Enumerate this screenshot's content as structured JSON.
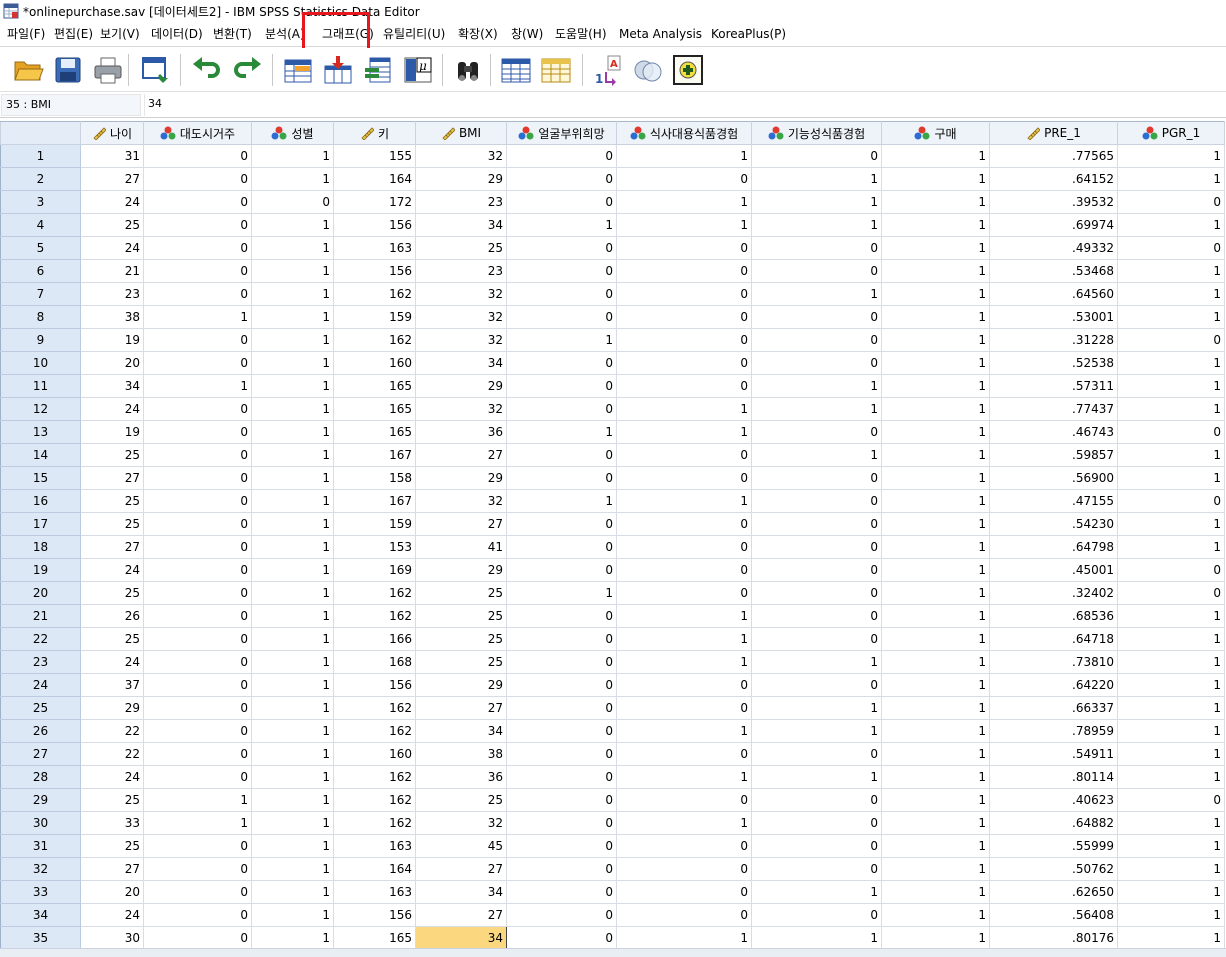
{
  "window": {
    "title": "*onlinepurchase.sav [데이터세트2] - IBM SPSS Statistics Data Editor"
  },
  "menu": [
    {
      "label": "파일(F)",
      "name": "menu-file"
    },
    {
      "label": "편집(E)",
      "name": "menu-edit"
    },
    {
      "label": "보기(V)",
      "name": "menu-view"
    },
    {
      "label": "데이터(D)",
      "name": "menu-data"
    },
    {
      "label": "변환(T)",
      "name": "menu-transform"
    },
    {
      "label": "분석(A)",
      "name": "menu-analyze"
    },
    {
      "label": "그래프(G)",
      "name": "menu-graphs"
    },
    {
      "label": "유틸리티(U)",
      "name": "menu-utilities"
    },
    {
      "label": "확장(X)",
      "name": "menu-extensions"
    },
    {
      "label": "창(W)",
      "name": "menu-window"
    },
    {
      "label": "도움말(H)",
      "name": "menu-help"
    },
    {
      "label": "Meta Analysis",
      "name": "menu-meta-analysis"
    },
    {
      "label": "KoreaPlus(P)",
      "name": "menu-koreaplus"
    }
  ],
  "toolbar": [
    {
      "icon": "open-folder-icon"
    },
    {
      "icon": "save-icon"
    },
    {
      "icon": "print-icon"
    },
    {
      "icon": "recall-dialog-icon"
    },
    {
      "icon": "undo-icon"
    },
    {
      "icon": "redo-icon"
    },
    {
      "icon": "goto-case-icon"
    },
    {
      "icon": "goto-variable-icon"
    },
    {
      "icon": "variables-icon"
    },
    {
      "icon": "descriptive-statistics-icon"
    },
    {
      "icon": "find-icon"
    },
    {
      "icon": "insert-cases-icon"
    },
    {
      "icon": "insert-variable-icon"
    },
    {
      "icon": "value-labels-icon"
    },
    {
      "icon": "use-variable-sets-icon"
    },
    {
      "icon": "show-all-variables-icon"
    }
  ],
  "cellbar": {
    "reference": "35 : BMI",
    "value": "34"
  },
  "columns": [
    {
      "label": "나이",
      "type": "scale"
    },
    {
      "label": "대도시거주",
      "type": "nominal"
    },
    {
      "label": "성별",
      "type": "nominal"
    },
    {
      "label": "키",
      "type": "scale"
    },
    {
      "label": "BMI",
      "type": "scale"
    },
    {
      "label": "얼굴부위희망",
      "type": "nominal"
    },
    {
      "label": "식사대용식품경험",
      "type": "nominal"
    },
    {
      "label": "기능성식품경험",
      "type": "nominal"
    },
    {
      "label": "구매",
      "type": "nominal"
    },
    {
      "label": "PRE_1",
      "type": "scale"
    },
    {
      "label": "PGR_1",
      "type": "nominal"
    }
  ],
  "rows": [
    [
      "1",
      "31",
      "0",
      "1",
      "155",
      "32",
      "0",
      "1",
      "0",
      "1",
      ".77565",
      "1"
    ],
    [
      "2",
      "27",
      "0",
      "1",
      "164",
      "29",
      "0",
      "0",
      "1",
      "1",
      ".64152",
      "1"
    ],
    [
      "3",
      "24",
      "0",
      "0",
      "172",
      "23",
      "0",
      "1",
      "1",
      "1",
      ".39532",
      "0"
    ],
    [
      "4",
      "25",
      "0",
      "1",
      "156",
      "34",
      "1",
      "1",
      "1",
      "1",
      ".69974",
      "1"
    ],
    [
      "5",
      "24",
      "0",
      "1",
      "163",
      "25",
      "0",
      "0",
      "0",
      "1",
      ".49332",
      "0"
    ],
    [
      "6",
      "21",
      "0",
      "1",
      "156",
      "23",
      "0",
      "0",
      "0",
      "1",
      ".53468",
      "1"
    ],
    [
      "7",
      "23",
      "0",
      "1",
      "162",
      "32",
      "0",
      "0",
      "1",
      "1",
      ".64560",
      "1"
    ],
    [
      "8",
      "38",
      "1",
      "1",
      "159",
      "32",
      "0",
      "0",
      "0",
      "1",
      ".53001",
      "1"
    ],
    [
      "9",
      "19",
      "0",
      "1",
      "162",
      "32",
      "1",
      "0",
      "0",
      "1",
      ".31228",
      "0"
    ],
    [
      "10",
      "20",
      "0",
      "1",
      "160",
      "34",
      "0",
      "0",
      "0",
      "1",
      ".52538",
      "1"
    ],
    [
      "11",
      "34",
      "1",
      "1",
      "165",
      "29",
      "0",
      "0",
      "1",
      "1",
      ".57311",
      "1"
    ],
    [
      "12",
      "24",
      "0",
      "1",
      "165",
      "32",
      "0",
      "1",
      "1",
      "1",
      ".77437",
      "1"
    ],
    [
      "13",
      "19",
      "0",
      "1",
      "165",
      "36",
      "1",
      "1",
      "0",
      "1",
      ".46743",
      "0"
    ],
    [
      "14",
      "25",
      "0",
      "1",
      "167",
      "27",
      "0",
      "0",
      "1",
      "1",
      ".59857",
      "1"
    ],
    [
      "15",
      "27",
      "0",
      "1",
      "158",
      "29",
      "0",
      "0",
      "0",
      "1",
      ".56900",
      "1"
    ],
    [
      "16",
      "25",
      "0",
      "1",
      "167",
      "32",
      "1",
      "1",
      "0",
      "1",
      ".47155",
      "0"
    ],
    [
      "17",
      "25",
      "0",
      "1",
      "159",
      "27",
      "0",
      "0",
      "0",
      "1",
      ".54230",
      "1"
    ],
    [
      "18",
      "27",
      "0",
      "1",
      "153",
      "41",
      "0",
      "0",
      "0",
      "1",
      ".64798",
      "1"
    ],
    [
      "19",
      "24",
      "0",
      "1",
      "169",
      "29",
      "0",
      "0",
      "0",
      "1",
      ".45001",
      "0"
    ],
    [
      "20",
      "25",
      "0",
      "1",
      "162",
      "25",
      "1",
      "0",
      "0",
      "1",
      ".32402",
      "0"
    ],
    [
      "21",
      "26",
      "0",
      "1",
      "162",
      "25",
      "0",
      "1",
      "0",
      "1",
      ".68536",
      "1"
    ],
    [
      "22",
      "25",
      "0",
      "1",
      "166",
      "25",
      "0",
      "1",
      "0",
      "1",
      ".64718",
      "1"
    ],
    [
      "23",
      "24",
      "0",
      "1",
      "168",
      "25",
      "0",
      "1",
      "1",
      "1",
      ".73810",
      "1"
    ],
    [
      "24",
      "37",
      "0",
      "1",
      "156",
      "29",
      "0",
      "0",
      "0",
      "1",
      ".64220",
      "1"
    ],
    [
      "25",
      "29",
      "0",
      "1",
      "162",
      "27",
      "0",
      "0",
      "1",
      "1",
      ".66337",
      "1"
    ],
    [
      "26",
      "22",
      "0",
      "1",
      "162",
      "34",
      "0",
      "1",
      "1",
      "1",
      ".78959",
      "1"
    ],
    [
      "27",
      "22",
      "0",
      "1",
      "160",
      "38",
      "0",
      "0",
      "0",
      "1",
      ".54911",
      "1"
    ],
    [
      "28",
      "24",
      "0",
      "1",
      "162",
      "36",
      "0",
      "1",
      "1",
      "1",
      ".80114",
      "1"
    ],
    [
      "29",
      "25",
      "1",
      "1",
      "162",
      "25",
      "0",
      "0",
      "0",
      "1",
      ".40623",
      "0"
    ],
    [
      "30",
      "33",
      "1",
      "1",
      "162",
      "32",
      "0",
      "1",
      "0",
      "1",
      ".64882",
      "1"
    ],
    [
      "31",
      "25",
      "0",
      "1",
      "163",
      "45",
      "0",
      "0",
      "0",
      "1",
      ".55999",
      "1"
    ],
    [
      "32",
      "27",
      "0",
      "1",
      "164",
      "27",
      "0",
      "0",
      "0",
      "1",
      ".50762",
      "1"
    ],
    [
      "33",
      "20",
      "0",
      "1",
      "163",
      "34",
      "0",
      "0",
      "1",
      "1",
      ".62650",
      "1"
    ],
    [
      "34",
      "24",
      "0",
      "1",
      "156",
      "27",
      "0",
      "0",
      "0",
      "1",
      ".56408",
      "1"
    ],
    [
      "35",
      "30",
      "0",
      "1",
      "165",
      "34",
      "0",
      "1",
      "1",
      "1",
      ".80176",
      "1"
    ]
  ],
  "selected": {
    "row": 35,
    "column": "BMI"
  },
  "colors": {
    "highlight_box": "#e8171e",
    "selected_cell": "#fbd87f",
    "row_header": "#dce8f6",
    "column_header": "#eef3f9"
  }
}
